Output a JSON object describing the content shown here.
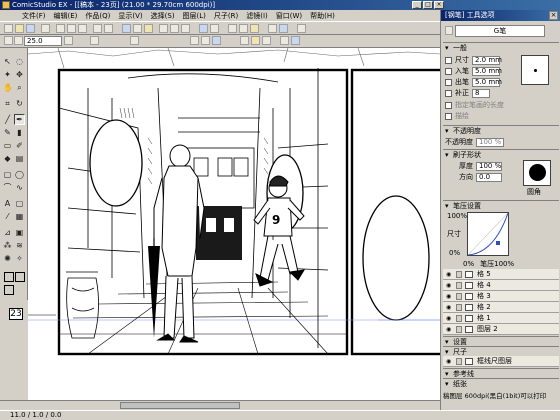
{
  "window": {
    "title": "ComicStudio EX - [[稿本 - 23页] (21.00 * 29.70cm 600dpi)]",
    "min": "_",
    "max": "□",
    "close": "×"
  },
  "menu": [
    "文件(F)",
    "编辑(E)",
    "作品(Q)",
    "显示(V)",
    "选择(S)",
    "图层(L)",
    "尺子(R)",
    "滤镜(I)",
    "窗口(W)",
    "帮助(H)"
  ],
  "toolbar": {
    "zoom_value": "25.0"
  },
  "page_number": "23",
  "statusbar": {
    "left": "11.0 / 1.0 / 0.0"
  },
  "tool_options": {
    "title": "[钢笔] 工具选项",
    "close": "×",
    "selected_tool": "G笔",
    "general": {
      "header": "一般",
      "size_label": "尺寸",
      "size_value": "2.0 mm",
      "entry_label": "入笔",
      "entry_value": "5.0 mm",
      "exit_label": "出笔",
      "exit_value": "5.0 mm",
      "correction_label": "补正",
      "correction_value": "8",
      "option1": "指定笔画的长度",
      "option2": "描绘"
    },
    "opacity": {
      "header": "不透明度",
      "label": "不透明度",
      "value": "100 %"
    },
    "brush_shape": {
      "header": "刷子形状",
      "thickness_label": "厚度",
      "thickness_value": "100 %",
      "direction_label": "方向",
      "direction_value": "0.0",
      "circle_label": "圆角"
    },
    "pressure": {
      "header": "笔压设置",
      "axis_top": "100%",
      "axis_label": "尺寸",
      "axis_bottom": "0%",
      "footer_left": "0%",
      "footer_label": "笔压",
      "footer_right": "100%"
    }
  },
  "layers": {
    "rows": [
      "格 5",
      "格 4",
      "格 3",
      "格 2",
      "格 1",
      "图层 2"
    ],
    "sections": [
      "设置",
      "尺子",
      "参考线"
    ],
    "ruler_layer": "框线尺图层",
    "ruler_folder": "纸张",
    "status": "稿图层 600dpi(黑白(1bit)可以打印"
  },
  "colors": {
    "titlebar_start": "#0a246a",
    "titlebar_end": "#3a6ea5",
    "chrome": "#d4d0c8",
    "canvas": "#ffffff",
    "swatch_black": "#000000",
    "swatch_white": "#ffffff",
    "swatch_blue": "#6080d0"
  },
  "icons": [
    "select-icon",
    "lasso-icon",
    "magic-wand-icon",
    "move-icon",
    "hand-icon",
    "zoom-icon",
    "pen-icon",
    "pencil-icon",
    "marker-icon",
    "eraser-icon",
    "brush-icon",
    "fill-icon",
    "gradient-icon",
    "rect-icon",
    "ellipse-icon",
    "line-icon",
    "text-icon",
    "eyedropper-icon",
    "ruler-icon",
    "eye-icon",
    "layer-icon"
  ]
}
